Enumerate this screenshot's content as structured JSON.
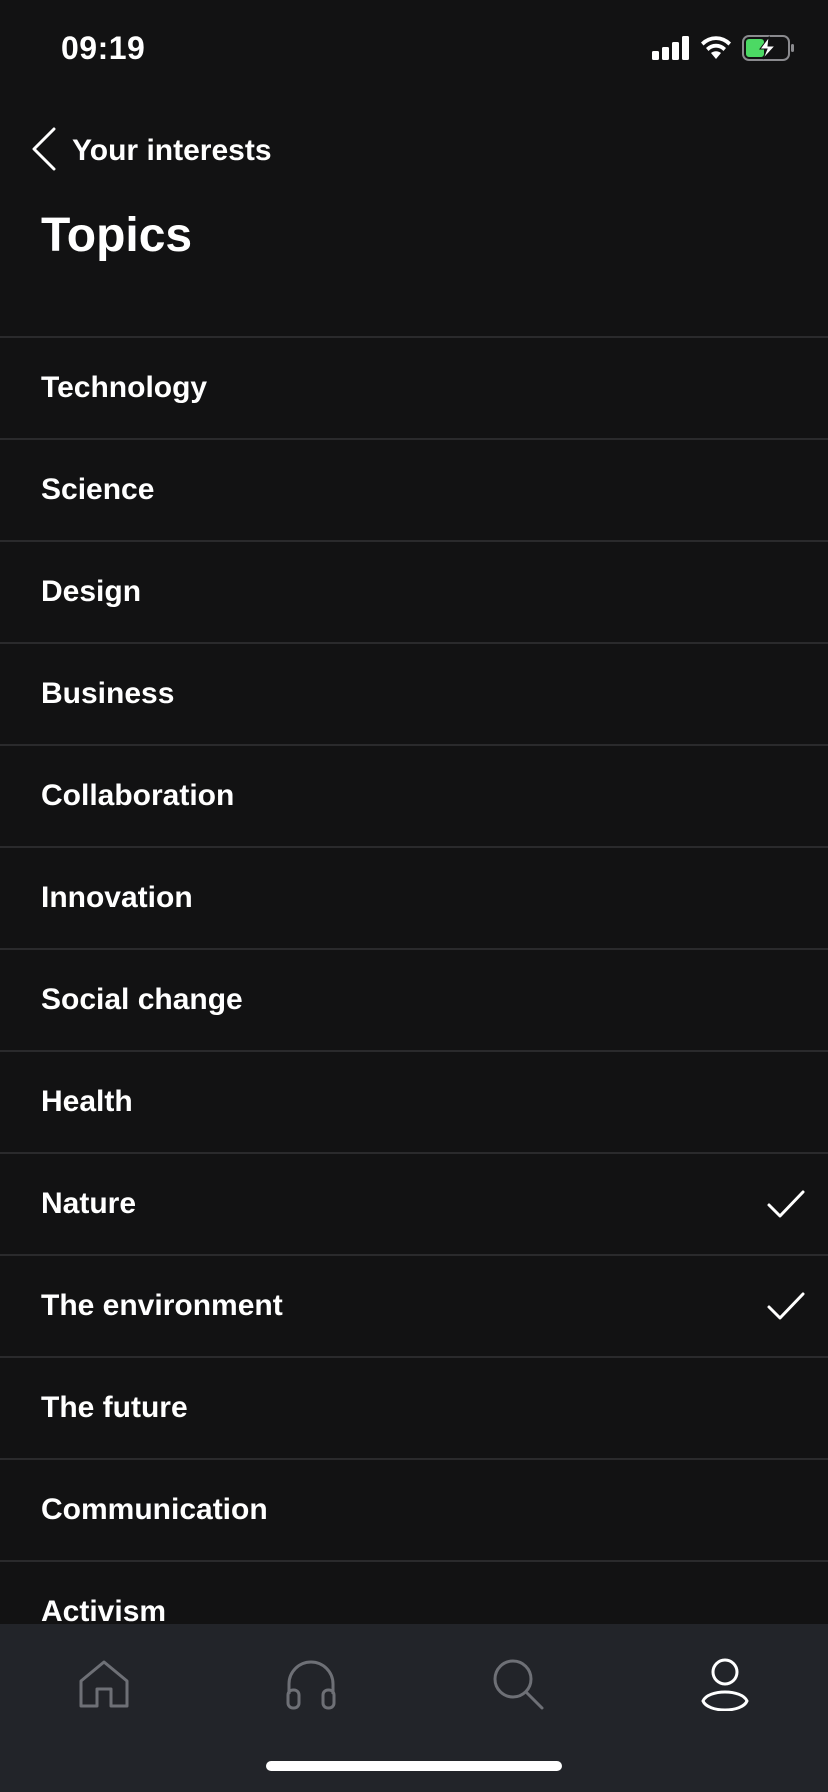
{
  "status_bar": {
    "time": "09:19",
    "icons": [
      "cellular-signal-icon",
      "wifi-icon",
      "battery-charging-icon"
    ],
    "battery_color": "#4cd964"
  },
  "nav": {
    "back_label": "Your interests",
    "back_icon": "chevron-left-icon"
  },
  "page": {
    "title": "Topics"
  },
  "topics": [
    {
      "label": "Technology",
      "selected": false
    },
    {
      "label": "Science",
      "selected": false
    },
    {
      "label": "Design",
      "selected": false
    },
    {
      "label": "Business",
      "selected": false
    },
    {
      "label": "Collaboration",
      "selected": false
    },
    {
      "label": "Innovation",
      "selected": false
    },
    {
      "label": "Social change",
      "selected": false
    },
    {
      "label": "Health",
      "selected": false
    },
    {
      "label": "Nature",
      "selected": true
    },
    {
      "label": "The environment",
      "selected": true
    },
    {
      "label": "The future",
      "selected": false
    },
    {
      "label": "Communication",
      "selected": false
    },
    {
      "label": "Activism",
      "selected": false
    }
  ],
  "tab_bar": {
    "tabs": [
      {
        "icon": "home-icon",
        "active": false
      },
      {
        "icon": "headphones-icon",
        "active": false
      },
      {
        "icon": "search-icon",
        "active": false
      },
      {
        "icon": "profile-icon",
        "active": true
      }
    ],
    "inactive_color": "#6e7076",
    "active_color": "#ffffff"
  },
  "colors": {
    "background": "#121213",
    "divider": "#2a2a2c",
    "tab_bar_background": "#222429",
    "text": "#ffffff"
  }
}
